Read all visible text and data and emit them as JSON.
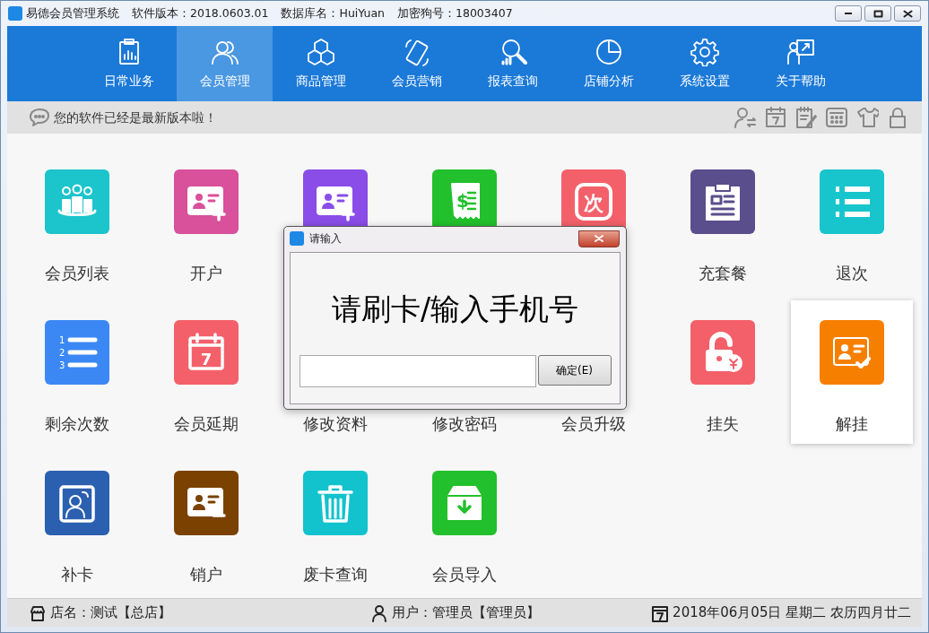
{
  "window": {
    "app_name": "易德会员管理系统",
    "info": [
      "软件版本：2018.0603.01",
      "数据库名：HuiYuan",
      "加密狗号：18003407"
    ]
  },
  "nav": [
    {
      "label": "日常业务",
      "selected": false
    },
    {
      "label": "会员管理",
      "selected": true
    },
    {
      "label": "商品管理",
      "selected": false
    },
    {
      "label": "会员营销",
      "selected": false
    },
    {
      "label": "报表查询",
      "selected": false
    },
    {
      "label": "店铺分析",
      "selected": false
    },
    {
      "label": "系统设置",
      "selected": false
    },
    {
      "label": "关于帮助",
      "selected": false
    }
  ],
  "notice": "您的软件已经是最新版本啦！",
  "tiles": [
    {
      "label": "会员列表",
      "color": "#1cc4cc",
      "selected": false
    },
    {
      "label": "开户",
      "color": "#d9509b",
      "selected": false
    },
    {
      "color": "#8a4de8",
      "selected": false
    },
    {
      "color": "#22c02c",
      "icon_text": [
        "$"
      ],
      "selected": false
    },
    {
      "color": "#f4606a",
      "icon_text": [
        "次"
      ],
      "selected": false
    },
    {
      "label": "充套餐",
      "color": "#5b4e8c",
      "selected": false
    },
    {
      "label": "退次",
      "color": "#19c5cc",
      "selected": false
    },
    {
      "label": "剩余次数",
      "color": "#3b88f5",
      "icon_text": [
        "1",
        "2",
        "3"
      ],
      "selected": false
    },
    {
      "label": "会员延期",
      "color": "#f4606a",
      "icon_text": [
        "7"
      ],
      "selected": false
    },
    {
      "label": "修改资料",
      "selected": false
    },
    {
      "label": "修改密码",
      "selected": false
    },
    {
      "label": "会员升级",
      "selected": false
    },
    {
      "label": "挂失",
      "color": "#f4606a",
      "selected": false
    },
    {
      "label": "解挂",
      "color": "#f77f00",
      "selected": true
    },
    {
      "label": "补卡",
      "color": "#2b5fb0",
      "selected": false
    },
    {
      "label": "销户",
      "color": "#7a4100",
      "selected": false
    },
    {
      "label": "废卡查询",
      "color": "#12c2cc",
      "selected": false
    },
    {
      "label": "会员导入",
      "color": "#22c02c",
      "selected": false
    }
  ],
  "status_bar": {
    "shop": "店名：测试【总店】",
    "user": "用户：管理员【管理员】",
    "date": "2018年06月05日 星期二 农历四月廿二"
  },
  "dialog": {
    "title": "请输入",
    "prompt": "请刷卡/输入手机号",
    "button": "确定(E)"
  }
}
